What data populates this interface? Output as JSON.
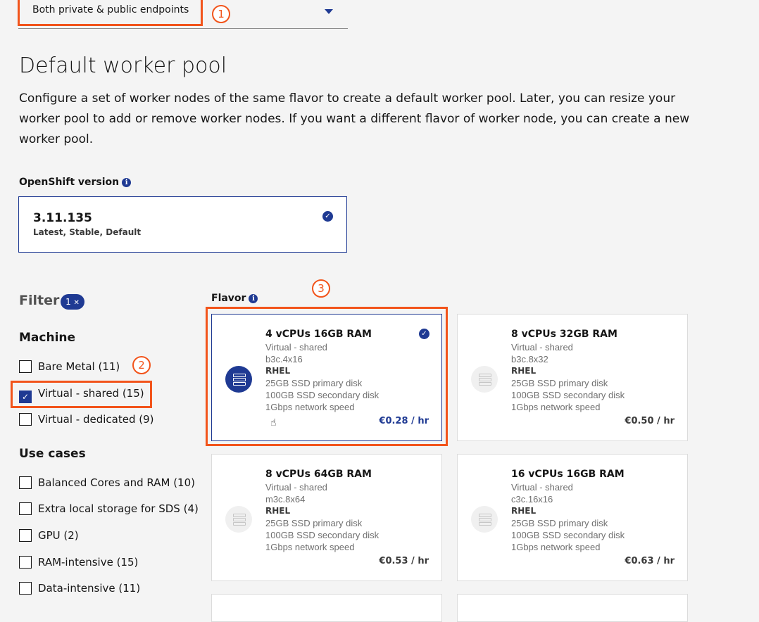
{
  "endpoint": {
    "value": "Both private & public endpoints",
    "callout": "1"
  },
  "page": {
    "title": "Default worker pool",
    "description": "Configure a set of worker nodes of the same flavor to create a default worker pool. Later, you can resize your worker pool to add or remove worker nodes. If you want a different flavor of worker node, you can create a new worker pool."
  },
  "openshift": {
    "label": "OpenShift version",
    "version": "3.11.135",
    "tags": "Latest, Stable, Default",
    "selected": true
  },
  "filter": {
    "title": "Filter",
    "badge_count": "1",
    "badge_clear": "✕",
    "machine": {
      "title": "Machine",
      "items": [
        {
          "label": "Bare Metal (11)",
          "checked": false
        },
        {
          "label": "Virtual - shared (15)",
          "checked": true
        },
        {
          "label": "Virtual - dedicated (9)",
          "checked": false
        }
      ],
      "callout": "2"
    },
    "use_cases": {
      "title": "Use cases",
      "items": [
        {
          "label": "Balanced Cores and RAM (10)",
          "checked": false
        },
        {
          "label": "Extra local storage for SDS (4)",
          "checked": false
        },
        {
          "label": "GPU (2)",
          "checked": false
        },
        {
          "label": "RAM-intensive (15)",
          "checked": false
        },
        {
          "label": "Data-intensive (11)",
          "checked": false
        }
      ]
    }
  },
  "flavor": {
    "label": "Flavor",
    "callout": "3",
    "tiles": [
      {
        "name": "4 vCPUs 16GB RAM",
        "type": "Virtual - shared",
        "id": "b3c.4x16",
        "os": "RHEL",
        "disk1": "25GB SSD primary disk",
        "disk2": "100GB SSD secondary disk",
        "network": "1Gbps network speed",
        "price": "€0.28 / hr",
        "selected": true
      },
      {
        "name": "8 vCPUs 32GB RAM",
        "type": "Virtual - shared",
        "id": "b3c.8x32",
        "os": "RHEL",
        "disk1": "25GB SSD primary disk",
        "disk2": "100GB SSD secondary disk",
        "network": "1Gbps network speed",
        "price": "€0.50 / hr",
        "selected": false
      },
      {
        "name": "8 vCPUs 64GB RAM",
        "type": "Virtual - shared",
        "id": "m3c.8x64",
        "os": "RHEL",
        "disk1": "25GB SSD primary disk",
        "disk2": "100GB SSD secondary disk",
        "network": "1Gbps network speed",
        "price": "€0.53 / hr",
        "selected": false
      },
      {
        "name": "16 vCPUs 16GB RAM",
        "type": "Virtual - shared",
        "id": "c3c.16x16",
        "os": "RHEL",
        "disk1": "25GB SSD primary disk",
        "disk2": "100GB SSD secondary disk",
        "network": "1Gbps network speed",
        "price": "€0.63 / hr",
        "selected": false
      }
    ]
  },
  "icons": {
    "info": "info-icon",
    "check": "checkmark-icon",
    "server": "server-icon",
    "caret": "chevron-down-icon",
    "cursor": "hand-cursor-icon"
  },
  "colors": {
    "accent": "#1f3a93",
    "annotation": "#f2541b",
    "background": "#f4f4f4"
  }
}
